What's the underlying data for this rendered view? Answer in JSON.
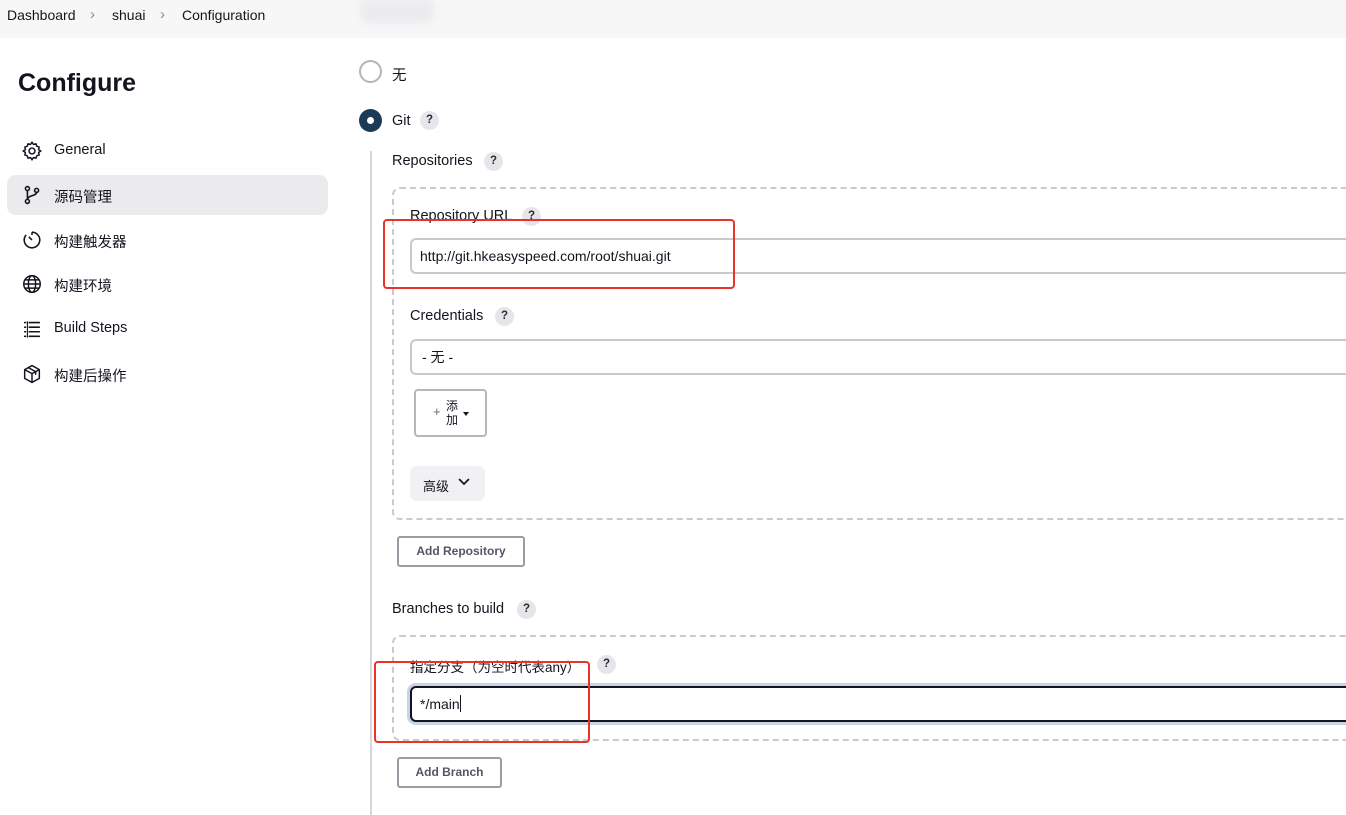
{
  "breadcrumb": [
    "Dashboard",
    "shuai",
    "Configuration"
  ],
  "sidebar": {
    "title": "Configure",
    "items": [
      {
        "label": "General",
        "icon": "gear-icon"
      },
      {
        "label": "源码管理",
        "icon": "branch-icon",
        "active": true
      },
      {
        "label": "构建触发器",
        "icon": "timer-icon"
      },
      {
        "label": "构建环境",
        "icon": "globe-icon"
      },
      {
        "label": "Build Steps",
        "icon": "list-icon"
      },
      {
        "label": "构建后操作",
        "icon": "package-icon"
      }
    ]
  },
  "scm": {
    "options": [
      {
        "label": "无",
        "selected": false
      },
      {
        "label": "Git",
        "selected": true
      }
    ],
    "help": "?",
    "repositories_label": "Repositories",
    "repository_url_label": "Repository URL",
    "repository_url_value": "http://git.hkeasyspeed.com/root/shuai.git",
    "credentials_label": "Credentials",
    "credentials_value": "- 无 -",
    "add_button_label": "添加",
    "add_button_plus": "+",
    "advanced_button_label": "高级",
    "add_repository_button": "Add Repository",
    "branches_label": "Branches to build",
    "branch_specifier_label": "指定分支（为空时代表any）",
    "branch_specifier_value": "*/main",
    "add_branch_button": "Add Branch"
  },
  "colors": {
    "accent": "#1c3a56",
    "highlight": "#e8332b",
    "active_nav_bg": "#ebebee"
  }
}
